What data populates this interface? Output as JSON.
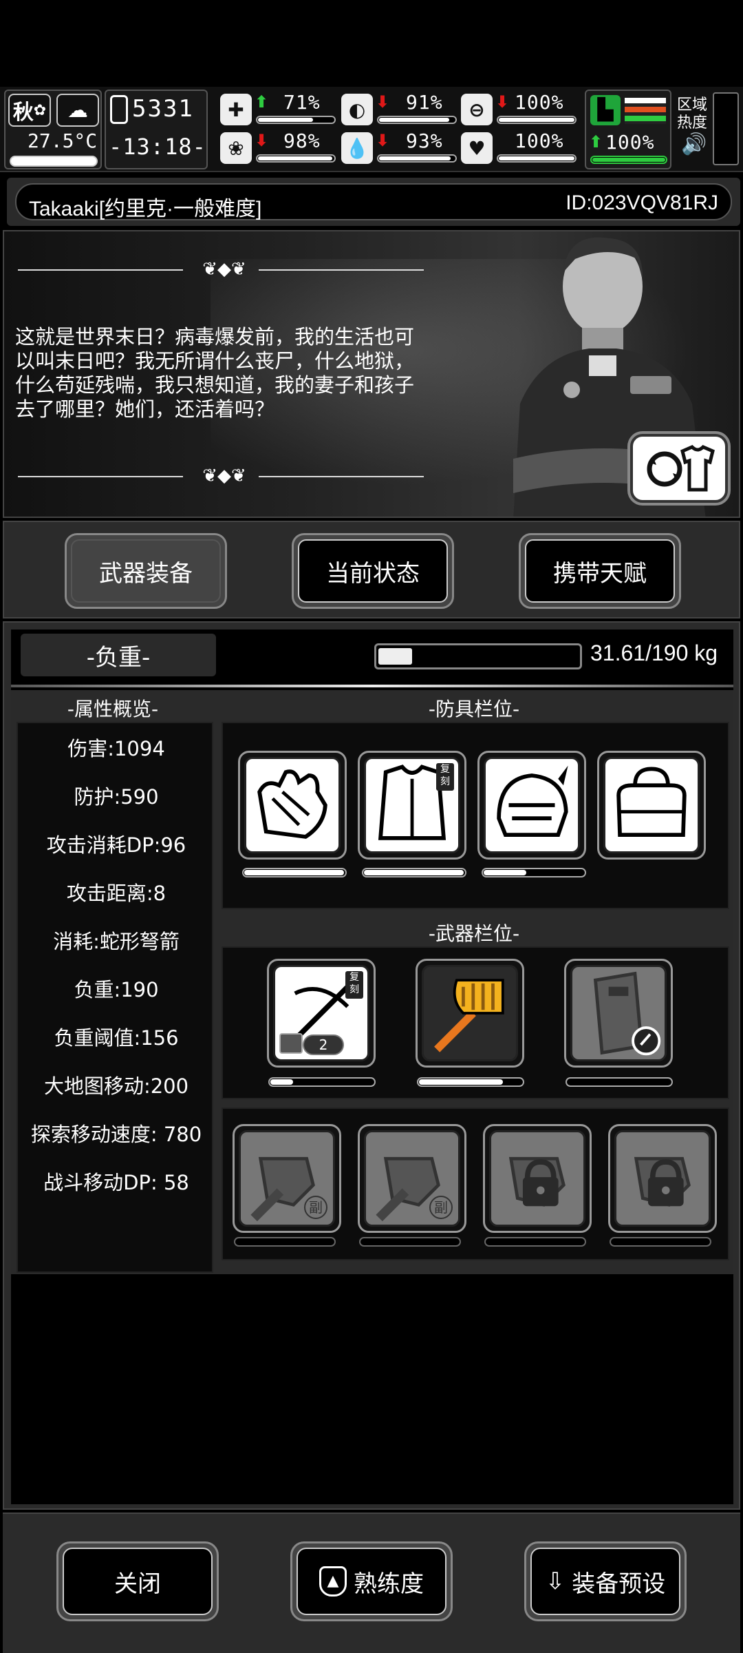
{
  "status": {
    "season": "秋",
    "temperature": "27.5°C",
    "day": "5331",
    "time": "-13:18-",
    "health": {
      "value": "71%",
      "trend": "up",
      "level": 0.71
    },
    "hunger": {
      "value": "91%",
      "trend": "down",
      "level": 0.91
    },
    "energy": {
      "value": "100%",
      "trend": "down",
      "level": 1.0
    },
    "mood": {
      "value": "98%",
      "trend": "down",
      "level": 0.98
    },
    "thirst": {
      "value": "93%",
      "trend": "down",
      "level": 0.93
    },
    "heart": {
      "value": "100%",
      "trend": "none",
      "level": 1.0
    },
    "stamina": {
      "value": "100%",
      "trend": "up",
      "level": 1.0
    },
    "region_heat_label": "区域热度"
  },
  "character": {
    "name": "Takaaki[约里克·一般难度]",
    "id": "ID:023VQV81RJ",
    "story": "这就是世界末日？病毒爆发前，我的生活也可以叫末日吧？我无所谓什么丧尸，什么地狱，什么苟延残喘，我只想知道，我的妻子和孩子去了哪里？她们，还活着吗？"
  },
  "tabs": [
    {
      "label": "武器装备",
      "active": true
    },
    {
      "label": "当前状态",
      "active": false
    },
    {
      "label": "携带天赋",
      "active": false
    }
  ],
  "load": {
    "title": "-负重-",
    "value": "31.61/190 kg",
    "fraction": 0.166
  },
  "attributes": {
    "heading": "-属性概览-",
    "rows": [
      "伤害:1094",
      "防护:590",
      "攻击消耗DP:96",
      "攻击距离:8",
      "消耗:蛇形弩箭",
      "负重:190",
      "负重阈值:156",
      "大地图移动:200",
      "探索移动速度:  780",
      "战斗移动DP:  58"
    ]
  },
  "armor": {
    "heading": "-防具栏位-",
    "slots": [
      {
        "item": "gloves",
        "durability": 1.0
      },
      {
        "item": "coat",
        "tag": "复刻",
        "durability": 1.0
      },
      {
        "item": "helmet",
        "durability": 0.42
      },
      {
        "item": "bag"
      }
    ]
  },
  "weapons": {
    "heading": "-武器栏位-",
    "slots": [
      {
        "item": "crossbow",
        "tag": "复刻",
        "ammo_count": "2",
        "durability": 0.22
      },
      {
        "item": "golden-hammer",
        "durability": 0.8
      },
      {
        "item": "riot-shield",
        "durability": 0
      }
    ]
  },
  "sub_slots": {
    "badge": "副",
    "slots": [
      "secondary",
      "secondary",
      "locked",
      "locked"
    ]
  },
  "buttons": {
    "close": "关闭",
    "proficiency": "熟练度",
    "preset": "装备预设"
  }
}
